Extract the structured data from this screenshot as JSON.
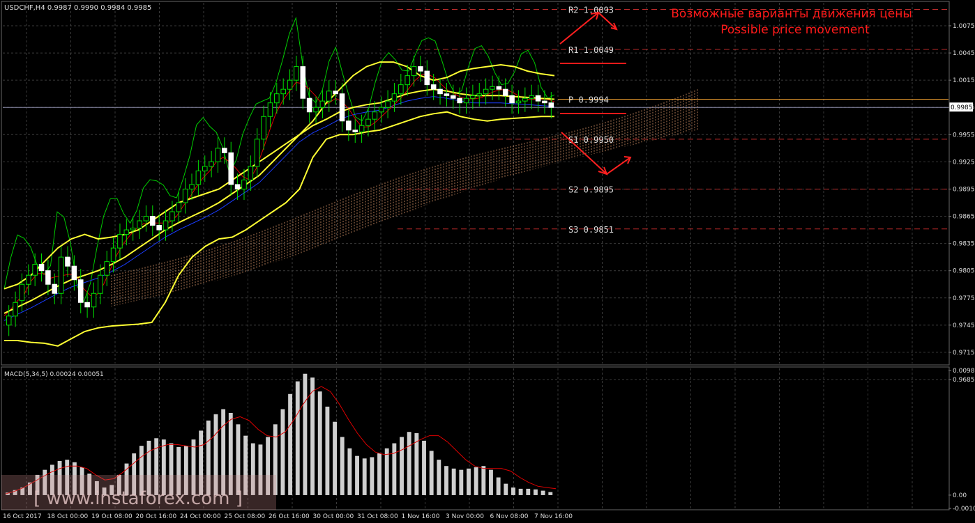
{
  "header": {
    "title": "USDCHF,H4  0.9987 0.9990 0.9984 0.9985"
  },
  "annotation": {
    "ru": "Возможные варианты движения цены",
    "en": "Possible price movement",
    "color": "#ff1a1a"
  },
  "watermark": "[ www.instaforex.com ]",
  "colors": {
    "background": "#000000",
    "grid": "#3a3a3a",
    "candle": "#00e000",
    "bollinger": "#ffff33",
    "ma_red": "#e00000",
    "ma_blue": "#1a3cff",
    "ma_green": "#00cc00",
    "cloud": "#e8a070",
    "pivot": "#ffaa33",
    "macd_hist": "#cfcfcf",
    "macd_signal": "#e00000",
    "level_dash": "#ff3b3b"
  },
  "chart_data": [
    {
      "type": "candlestick",
      "symbol": "USDCHF",
      "timeframe": "H4",
      "ylim": [
        0.9685,
        1.0075
      ],
      "y_ticks": [
        "1.0075",
        "1.0045",
        "1.0015",
        "0.9985",
        "0.9955",
        "0.9925",
        "0.9895",
        "0.9865",
        "0.9835",
        "0.9805",
        "0.9775",
        "0.9745",
        "0.9715",
        "0.9685"
      ],
      "current_price": "0.9985",
      "x_ticks": [
        "16 Oct 2017",
        "18 Oct 00:00",
        "19 Oct 08:00",
        "20 Oct 16:00",
        "24 Oct 00:00",
        "25 Oct 08:00",
        "26 Oct 16:00",
        "30 Oct 00:00",
        "31 Oct 08:00",
        "1 Nov 16:00",
        "3 Nov 00:00",
        "6 Nov 08:00",
        "7 Nov 16:00"
      ],
      "levels": [
        {
          "name": "R2",
          "value": 1.0093,
          "label": "R2 1.0093"
        },
        {
          "name": "R1",
          "value": 1.0049,
          "label": "R1 1.0049"
        },
        {
          "name": "P",
          "value": 0.9994,
          "label": "P 0.9994"
        },
        {
          "name": "S1",
          "value": 0.995,
          "label": "S1 0.9950"
        },
        {
          "name": "S2",
          "value": 0.9895,
          "label": "S2 0.9895"
        },
        {
          "name": "S3",
          "value": 0.9851,
          "label": "S3 0.9851"
        }
      ],
      "close": [
        0.9755,
        0.977,
        0.979,
        0.98,
        0.9812,
        0.9805,
        0.979,
        0.978,
        0.982,
        0.981,
        0.9795,
        0.977,
        0.9765,
        0.978,
        0.98,
        0.9815,
        0.983,
        0.9845,
        0.985,
        0.9852,
        0.986,
        0.9865,
        0.9855,
        0.985,
        0.986,
        0.987,
        0.988,
        0.9895,
        0.99,
        0.9915,
        0.992,
        0.9925,
        0.994,
        0.9935,
        0.99,
        0.9895,
        0.9905,
        0.992,
        0.995,
        0.9975,
        0.999,
        1.0,
        1.0005,
        1.0015,
        1.003,
        0.9995,
        0.998,
        0.9985,
        0.9992,
        1.0003,
        1.0,
        0.997,
        0.996,
        0.9958,
        0.9965,
        0.9972,
        0.998,
        0.9985,
        0.9992,
        1.0,
        1.001,
        1.002,
        1.003,
        1.0025,
        1.001,
        1.0005,
        1.0,
        0.9998,
        0.9995,
        0.999,
        0.9995,
        0.9998,
        1.0,
        1.0005,
        1.0008,
        1.0005,
        0.9998,
        0.999,
        0.9992,
        0.9995,
        0.9998,
        0.9992,
        0.999,
        0.9985
      ],
      "open": [
        0.9745,
        0.9755,
        0.9772,
        0.979,
        0.98,
        0.9812,
        0.9805,
        0.979,
        0.978,
        0.982,
        0.981,
        0.9795,
        0.977,
        0.9765,
        0.978,
        0.98,
        0.9815,
        0.983,
        0.9845,
        0.985,
        0.9852,
        0.986,
        0.9865,
        0.9855,
        0.985,
        0.986,
        0.987,
        0.988,
        0.9895,
        0.99,
        0.9915,
        0.992,
        0.9925,
        0.994,
        0.9935,
        0.99,
        0.9895,
        0.9905,
        0.992,
        0.995,
        0.9975,
        0.999,
        1.0,
        1.0005,
        1.0015,
        1.003,
        0.9995,
        0.998,
        0.9985,
        0.9992,
        1.0003,
        1.0,
        0.997,
        0.996,
        0.9958,
        0.9965,
        0.9972,
        0.998,
        0.9985,
        0.9992,
        1.0,
        1.001,
        1.002,
        1.003,
        1.0025,
        1.001,
        1.0005,
        1.0,
        0.9998,
        0.9995,
        0.999,
        0.9995,
        0.9998,
        1.0,
        1.0005,
        1.0008,
        1.0005,
        0.9998,
        0.999,
        0.9992,
        0.9995,
        0.9998,
        0.9992,
        0.999
      ],
      "bollinger_upper": [
        0.9785,
        0.979,
        0.98,
        0.9815,
        0.983,
        0.984,
        0.9845,
        0.984,
        0.9842,
        0.9845,
        0.985,
        0.986,
        0.987,
        0.988,
        0.9885,
        0.989,
        0.9895,
        0.9905,
        0.9915,
        0.9925,
        0.9935,
        0.9945,
        0.9955,
        0.997,
        0.999,
        1.0005,
        1.002,
        1.003,
        1.0035,
        1.0035,
        1.003,
        1.002,
        1.0015,
        1.0018,
        1.0025,
        1.0028,
        1.003,
        1.0032,
        1.003,
        1.0025,
        1.0022,
        1.002
      ],
      "bollinger_middle": [
        0.9758,
        0.9765,
        0.9772,
        0.978,
        0.9788,
        0.9795,
        0.98,
        0.9805,
        0.9812,
        0.982,
        0.983,
        0.984,
        0.985,
        0.9858,
        0.9865,
        0.9872,
        0.988,
        0.989,
        0.99,
        0.991,
        0.9925,
        0.994,
        0.9955,
        0.9965,
        0.9972,
        0.998,
        0.9985,
        0.9988,
        0.999,
        0.9995,
        1.0,
        1.0003,
        1.0005,
        1.0003,
        1.0,
        0.9998,
        0.9998,
        0.9998,
        0.9997,
        0.9996,
        0.9995,
        0.9994
      ],
      "bollinger_lower": [
        0.9728,
        0.9728,
        0.9726,
        0.9725,
        0.9722,
        0.973,
        0.9738,
        0.9742,
        0.9744,
        0.9745,
        0.9746,
        0.9748,
        0.977,
        0.98,
        0.982,
        0.9832,
        0.984,
        0.9842,
        0.985,
        0.986,
        0.987,
        0.988,
        0.9895,
        0.993,
        0.995,
        0.9955,
        0.9955,
        0.9958,
        0.996,
        0.9965,
        0.997,
        0.9975,
        0.9978,
        0.998,
        0.9975,
        0.9972,
        0.997,
        0.9972,
        0.9973,
        0.9974,
        0.9975,
        0.9975
      ]
    },
    {
      "type": "bar",
      "title": "MACD(5,34,5) 0.00024 0.00051",
      "ylim": [
        -0.00105,
        0.00986
      ],
      "y_ticks": [
        "0.00986",
        "0.00",
        "-0.00105"
      ],
      "values": [
        0.0002,
        0.0004,
        0.0006,
        0.001,
        0.0016,
        0.002,
        0.0024,
        0.0027,
        0.0028,
        0.0026,
        0.0022,
        0.0017,
        0.0011,
        0.0006,
        0.0008,
        0.0016,
        0.0025,
        0.0033,
        0.0039,
        0.0043,
        0.0045,
        0.0044,
        0.0041,
        0.0038,
        0.0039,
        0.0044,
        0.0051,
        0.0059,
        0.0064,
        0.0068,
        0.0065,
        0.0056,
        0.0047,
        0.0041,
        0.004,
        0.0046,
        0.0056,
        0.0068,
        0.008,
        0.009,
        0.0096,
        0.0093,
        0.0082,
        0.007,
        0.0058,
        0.0046,
        0.0037,
        0.0031,
        0.0029,
        0.003,
        0.0033,
        0.0037,
        0.0041,
        0.0046,
        0.005,
        0.0049,
        0.0043,
        0.0035,
        0.0028,
        0.0023,
        0.0021,
        0.002,
        0.0021,
        0.0022,
        0.0023,
        0.002,
        0.0014,
        0.0009,
        0.0006,
        0.0005,
        0.0005,
        0.00045,
        0.00035,
        0.00024
      ],
      "signal": [
        0.0001,
        0.0003,
        0.0006,
        0.001,
        0.0014,
        0.0018,
        0.0021,
        0.0023,
        0.0023,
        0.0021,
        0.0016,
        0.0012,
        0.0013,
        0.0018,
        0.0024,
        0.003,
        0.0035,
        0.0038,
        0.004,
        0.004,
        0.0039,
        0.0038,
        0.004,
        0.0046,
        0.0054,
        0.006,
        0.0062,
        0.0059,
        0.0052,
        0.0047,
        0.0046,
        0.005,
        0.006,
        0.0072,
        0.0082,
        0.0086,
        0.0082,
        0.0072,
        0.006,
        0.0049,
        0.004,
        0.0034,
        0.0032,
        0.0033,
        0.0036,
        0.004,
        0.0044,
        0.0047,
        0.0047,
        0.0042,
        0.0035,
        0.0028,
        0.0023,
        0.0021,
        0.0021,
        0.0021,
        0.0019,
        0.0014,
        0.001,
        0.0007,
        0.0006,
        0.00051
      ]
    }
  ]
}
